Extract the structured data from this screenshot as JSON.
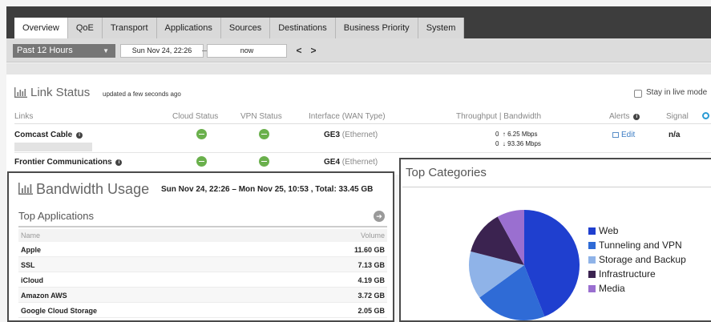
{
  "tabs": [
    {
      "label": "Overview",
      "active": true
    },
    {
      "label": "QoE"
    },
    {
      "label": "Transport"
    },
    {
      "label": "Applications"
    },
    {
      "label": "Sources"
    },
    {
      "label": "Destinations"
    },
    {
      "label": "Business Priority"
    },
    {
      "label": "System"
    }
  ],
  "timebar": {
    "range": "Past 12 Hours",
    "from": "Sun Nov 24, 22:26",
    "to": "now",
    "prev": "<",
    "next": ">"
  },
  "link_status": {
    "title": "Link Status",
    "updated": "updated a few seconds ago",
    "live_mode_label": "Stay in live mode",
    "headers": {
      "links": "Links",
      "cloud": "Cloud Status",
      "vpn": "VPN Status",
      "iface": "Interface (WAN Type)",
      "throughput": "Throughput | Bandwidth",
      "alerts": "Alerts",
      "signal": "Signal"
    },
    "rows": [
      {
        "link": "Comcast Cable",
        "iface": "GE3",
        "wan": "(Ethernet)",
        "tp_up": "0",
        "bw_up": "6.25 Mbps",
        "tp_down": "0",
        "bw_down": "93.36 Mbps",
        "alerts": "Edit",
        "signal": "n/a"
      },
      {
        "link": "Frontier Communications",
        "iface": "GE4",
        "wan": "(Ethernet)"
      }
    ]
  },
  "bandwidth": {
    "title": "Bandwidth Usage",
    "subtitle": "Sun Nov 24, 22:26 – Mon Nov 25, 10:53 , Total: 33.45 GB",
    "top_apps_title": "Top Applications",
    "col_name": "Name",
    "col_volume": "Volume",
    "apps": [
      {
        "name": "Apple",
        "volume": "11.60 GB"
      },
      {
        "name": "SSL",
        "volume": "7.13 GB"
      },
      {
        "name": "iCloud",
        "volume": "4.19 GB"
      },
      {
        "name": "Amazon AWS",
        "volume": "3.72 GB"
      },
      {
        "name": "Google Cloud Storage",
        "volume": "2.05 GB"
      }
    ]
  },
  "top_categories": {
    "title": "Top Categories",
    "items": [
      {
        "label": "Web",
        "color": "#1f3fcf",
        "share": 0.44
      },
      {
        "label": "Tunneling and VPN",
        "color": "#2f6bd6",
        "share": 0.21
      },
      {
        "label": "Storage and Backup",
        "color": "#8fb3e8",
        "share": 0.14
      },
      {
        "label": "Infrastructure",
        "color": "#3b2350",
        "share": 0.13
      },
      {
        "label": "Media",
        "color": "#9a6fd0",
        "share": 0.08
      }
    ]
  }
}
